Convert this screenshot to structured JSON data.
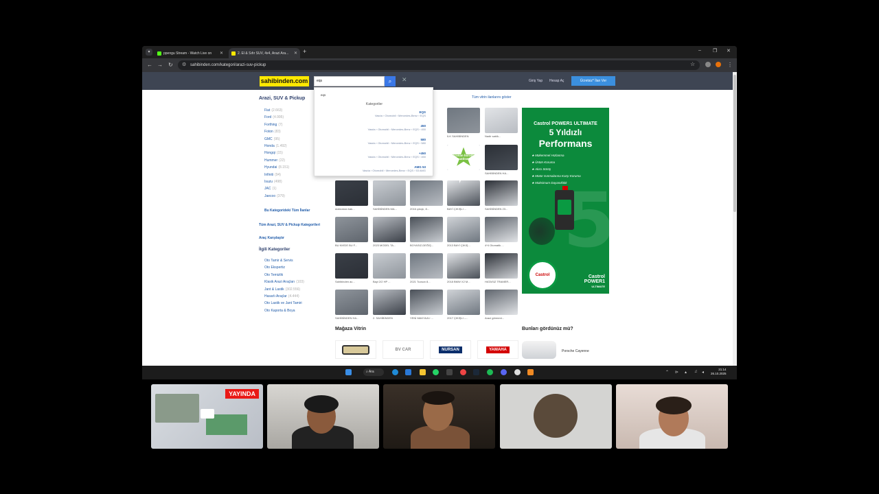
{
  "browser": {
    "tabs": [
      {
        "title": "ppengu Stream - Watch Live on",
        "favicon_color": "#53fc18",
        "active": false
      },
      {
        "title": "2. El & Sıfır SUV, 4x4, Arazi Ara...",
        "favicon_color": "#ffe800",
        "active": true
      }
    ],
    "address": "sahibinden.com/kategori/arazi-suv-pickup"
  },
  "site": {
    "logo": "sahibinden.com",
    "search_value": "eqs",
    "links": {
      "login": "Giriş Yap",
      "register": "Hesap Aç"
    },
    "cta": "Ücretsiz* İlan Ver",
    "show_all_showcase": "Tüm vitrin ilanlarını göster"
  },
  "sidebar": {
    "title": "Arazi, SUV & Pickup",
    "brands": [
      {
        "name": "Fiat",
        "count": "(2.663)"
      },
      {
        "name": "Ford",
        "count": "(4.995)"
      },
      {
        "name": "Forthing",
        "count": "(7)"
      },
      {
        "name": "Foton",
        "count": "(83)"
      },
      {
        "name": "GMC",
        "count": "(95)"
      },
      {
        "name": "Honda",
        "count": "(1.492)"
      },
      {
        "name": "Hongqi",
        "count": "(15)"
      },
      {
        "name": "Hummer",
        "count": "(22)"
      },
      {
        "name": "Hyundai",
        "count": "(8.151)"
      },
      {
        "name": "Infiniti",
        "count": "(94)"
      },
      {
        "name": "Isuzu",
        "count": "(498)"
      },
      {
        "name": "JAC",
        "count": "(1)"
      },
      {
        "name": "Jaecoo",
        "count": "(379)"
      }
    ],
    "all_in_category": "Bu Kategorideki Tüm İlanlar",
    "all_categories": "Tüm Arazi, SUV & Pickup Kategorileri",
    "compare": "Araç Karşılaştır",
    "related_title": "İlgili Kategoriler",
    "related": [
      {
        "name": "Oto Tamir & Servis",
        "count": ""
      },
      {
        "name": "Oto Ekspertiz",
        "count": ""
      },
      {
        "name": "Oto Temizlik",
        "count": ""
      },
      {
        "name": "Klasik Arazi Araçları",
        "count": "(103)"
      },
      {
        "name": "Jant & Lastik",
        "count": "(302.556)"
      },
      {
        "name": "Hasarlı Araçlar",
        "count": "(4.444)"
      },
      {
        "name": "Oto Lastik ve Jant Tamiri",
        "count": ""
      },
      {
        "name": "Oto Kaporta & Boya",
        "count": ""
      }
    ]
  },
  "dropdown": {
    "query": "eqs",
    "heading": "Kategoriler",
    "items": [
      {
        "model": "EQS",
        "path": "Vasıta › Otomobil › Mercedes-Benz › EQS"
      },
      {
        "model": "450",
        "path": "Vasıta › Otomobil › Mercedes-Benz › EQS › 450"
      },
      {
        "model": "580",
        "path": "Vasıta › Otomobil › Mercedes-Benz › EQS › 580"
      },
      {
        "model": "+450",
        "path": "Vasıta › Otomobil › Mercedes-Benz › EQS › 450"
      },
      {
        "model": "AMG 53",
        "path": "Vasıta › Otomobil › Mercedes-Benz › EQS › 53 AMG"
      }
    ]
  },
  "listings": {
    "top_captions": [
      "İLK SAHİBİNDEN",
      "Nadir satılk...",
      "SAHİBİNDEN HA..."
    ],
    "promo_badge": "Aranan burada satılsın",
    "rows": [
      [
        "doktordan bak...",
        "SAHİBİNDEN MA...",
        "2016 çıkışlı, 8...",
        "BAYİ ÇIKIŞLI ...",
        "SAHİBİNDEN 23..."
      ],
      [
        "BU KM'DE BU F...",
        "2023 MODEL TA...",
        "BOYASIZ-DEĞİŞ...",
        "2013 BAYİ ÇIKIŞ...",
        "4*4 Otomatik ..."
      ],
      [
        "Sahibinden ac...",
        "Bayi 2/2 HP ...",
        "2021 Tucson 8...",
        "2018 BMW X2 M...",
        "HATASIZ TRAMER..."
      ],
      [
        "SAHİBİNDEN HA...",
        "2. SAHİBİNDEN",
        "YENİ MAKYAJLI ...",
        "2017 ÇIKIŞLI –...",
        "Araci görmeni..."
      ]
    ]
  },
  "ad": {
    "brand": "Castrol POWER1 ULTIMATE",
    "headline_1": "5 Yıldızlı",
    "headline_2": "Performans",
    "features": [
      "Mükemmel Hızlanma",
      "Üstün Koruma",
      "Akıcı Sürüş",
      "Motor Isınmalarına Karşı Koruma",
      "Maksimum Dayanıklılık"
    ],
    "badge": "Castrol",
    "logo_1": "Castrol",
    "logo_2": "POWER1",
    "logo_3": "ULTIMATE",
    "bg_color": "#0c8a3c"
  },
  "stores": {
    "title": "Mağaza Vitrin",
    "items": [
      "",
      "BV CAR",
      "NURSAN",
      "YAMAHA"
    ]
  },
  "suggest": {
    "title": "Bunları gördünüz mü?",
    "item": "Porsche Cayenne"
  },
  "taskbar": {
    "search": "Ara",
    "time": "21:14",
    "date": "26.10.2025"
  },
  "cams": {
    "live_label": "YAYINDA"
  }
}
